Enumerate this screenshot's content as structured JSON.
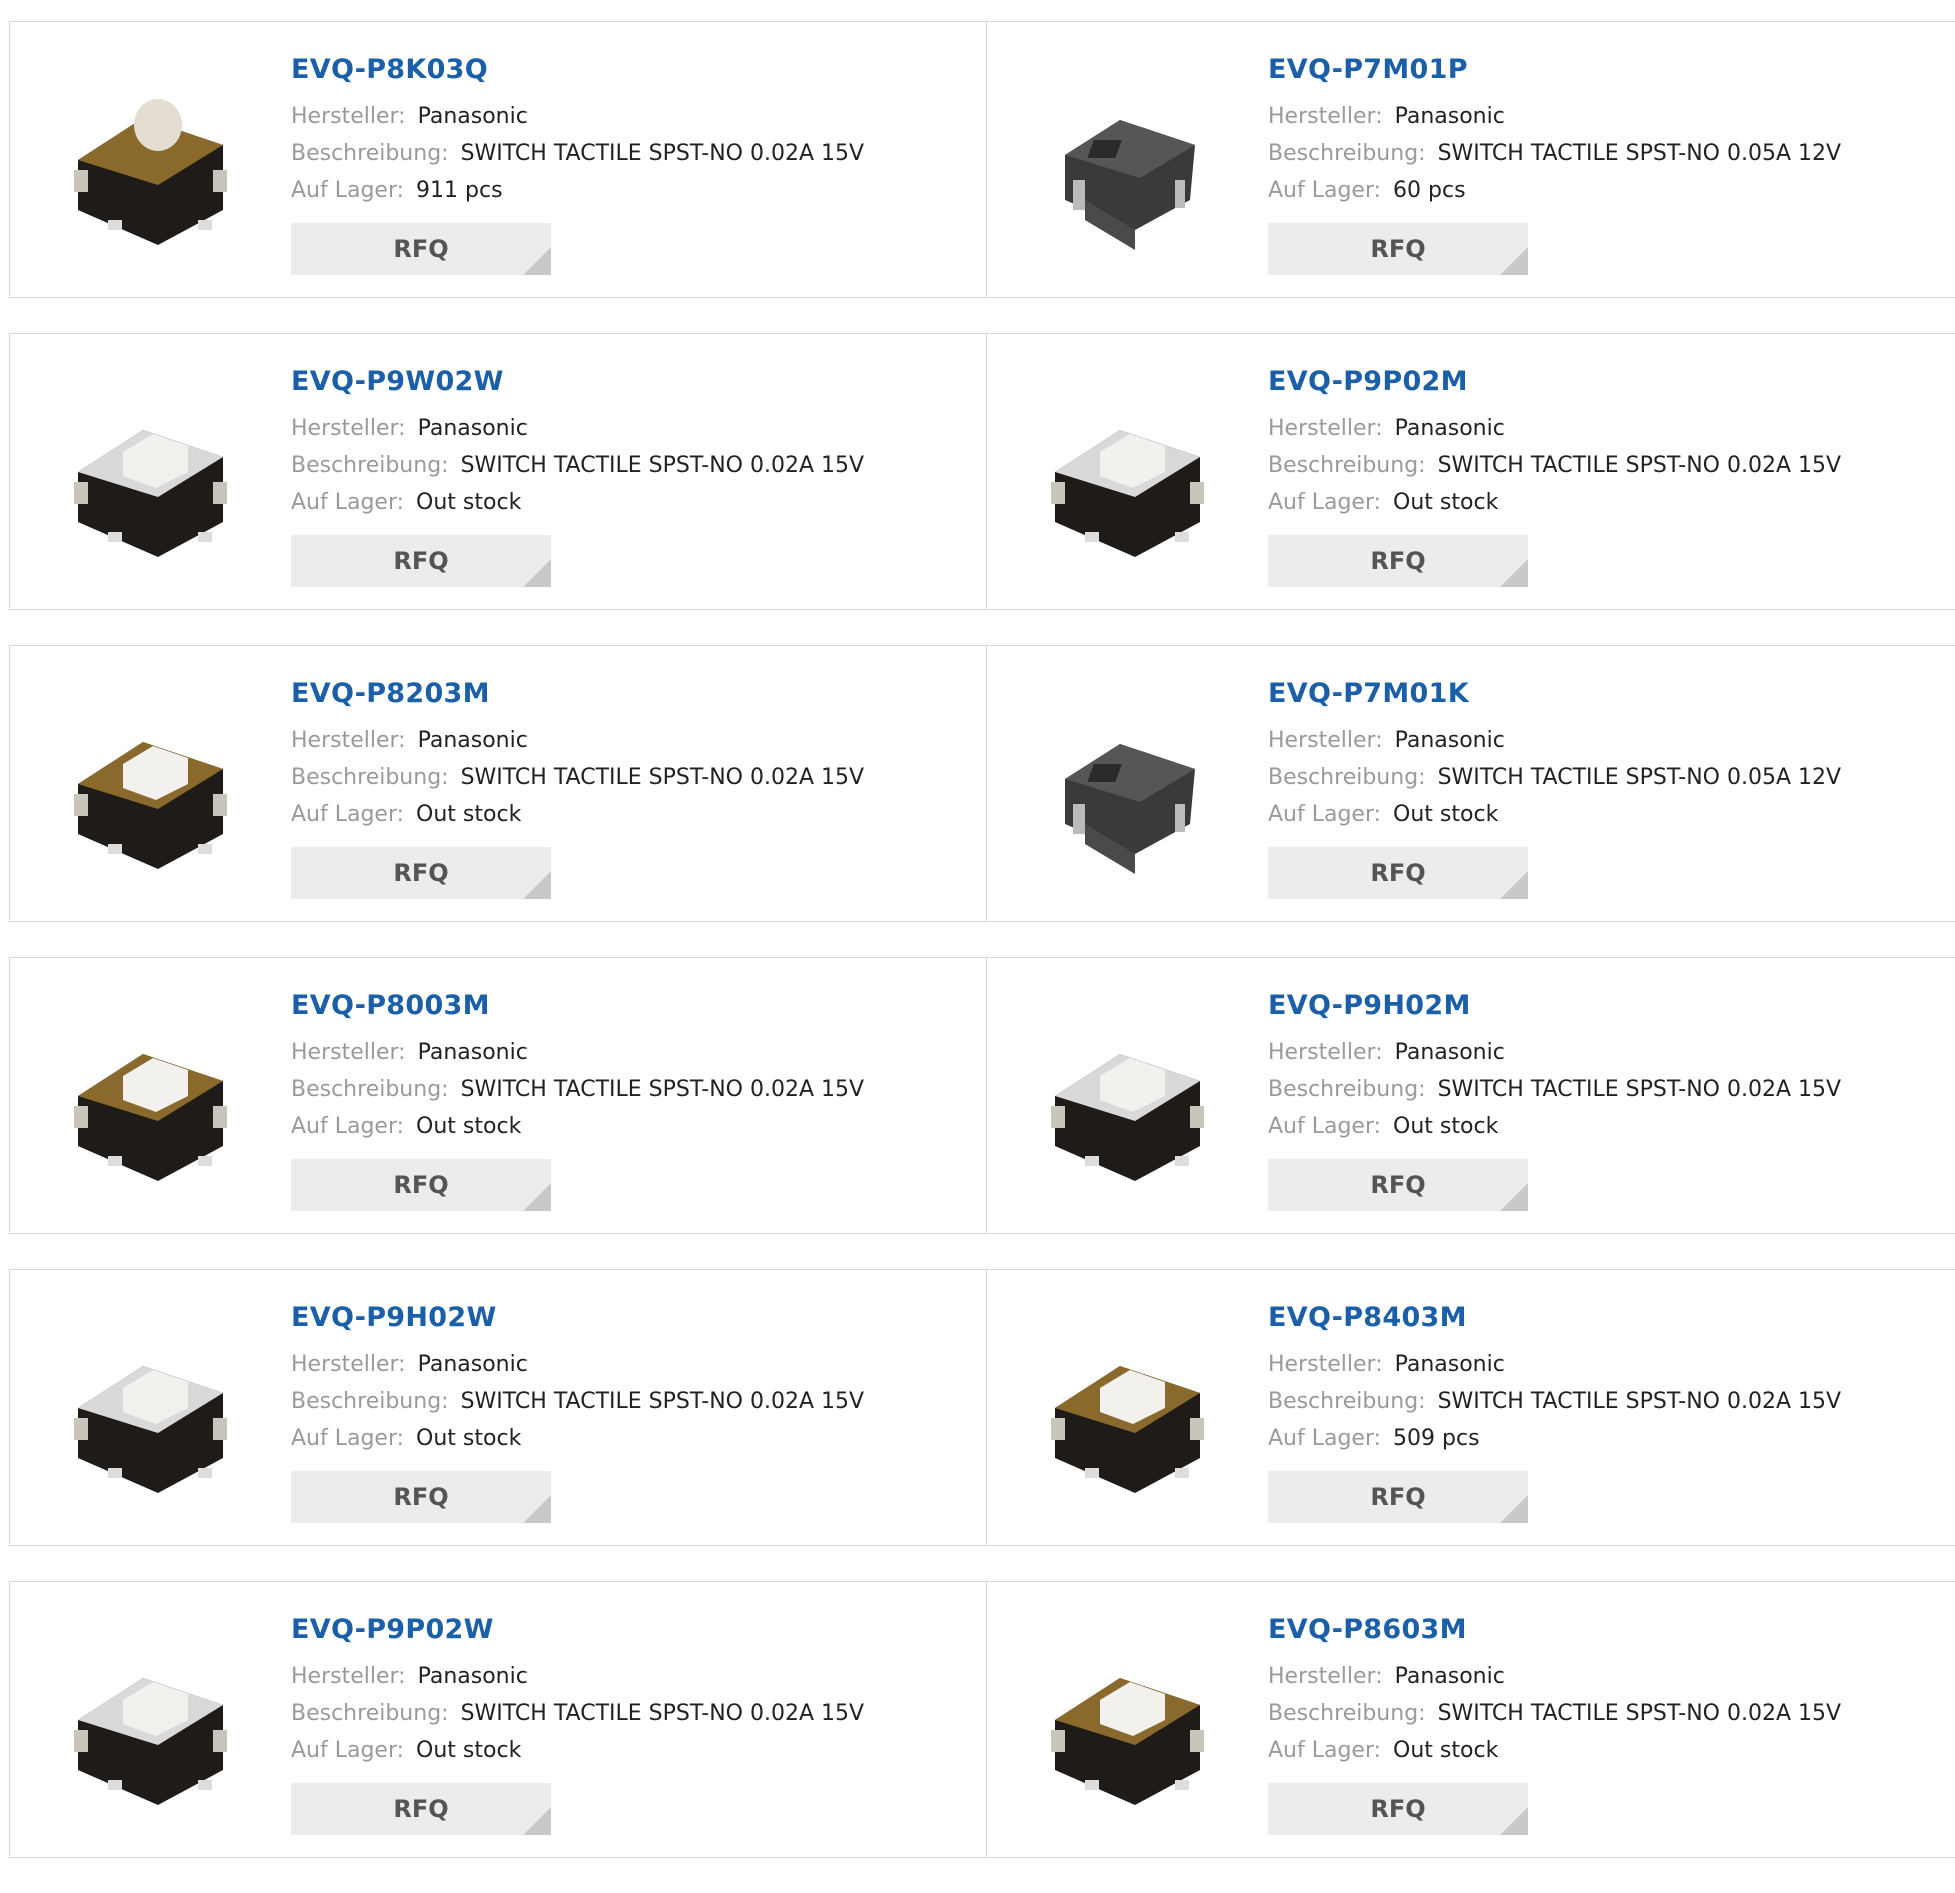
{
  "labels": {
    "manufacturer": "Hersteller:",
    "description": "Beschreibung:",
    "stock": "Auf Lager:",
    "rfq": "RFQ"
  },
  "products": [
    {
      "part": "EVQ-P8K03Q",
      "manufacturer": "Panasonic",
      "description": "SWITCH TACTILE SPST-NO 0.02A 15V",
      "stock": "911 pcs",
      "image": "switch-gold-round-icon"
    },
    {
      "part": "EVQ-P7M01P",
      "manufacturer": "Panasonic",
      "description": "SWITCH TACTILE SPST-NO 0.05A 12V",
      "stock": "60 pcs",
      "image": "switch-grey-side-icon"
    },
    {
      "part": "EVQ-P9W02W",
      "manufacturer": "Panasonic",
      "description": "SWITCH TACTILE SPST-NO 0.02A 15V",
      "stock": "Out stock",
      "image": "switch-silver-icon"
    },
    {
      "part": "EVQ-P9P02M",
      "manufacturer": "Panasonic",
      "description": "SWITCH TACTILE SPST-NO 0.02A 15V",
      "stock": "Out stock",
      "image": "switch-silver-icon"
    },
    {
      "part": "EVQ-P8203M",
      "manufacturer": "Panasonic",
      "description": "SWITCH TACTILE SPST-NO 0.02A 15V",
      "stock": "Out stock",
      "image": "switch-gold-icon"
    },
    {
      "part": "EVQ-P7M01K",
      "manufacturer": "Panasonic",
      "description": "SWITCH TACTILE SPST-NO 0.05A 12V",
      "stock": "Out stock",
      "image": "switch-grey-side-icon"
    },
    {
      "part": "EVQ-P8003M",
      "manufacturer": "Panasonic",
      "description": "SWITCH TACTILE SPST-NO 0.02A 15V",
      "stock": "Out stock",
      "image": "switch-gold-icon"
    },
    {
      "part": "EVQ-P9H02M",
      "manufacturer": "Panasonic",
      "description": "SWITCH TACTILE SPST-NO 0.02A 15V",
      "stock": "Out stock",
      "image": "switch-silver-icon"
    },
    {
      "part": "EVQ-P9H02W",
      "manufacturer": "Panasonic",
      "description": "SWITCH TACTILE SPST-NO 0.02A 15V",
      "stock": "Out stock",
      "image": "switch-silver-icon"
    },
    {
      "part": "EVQ-P8403M",
      "manufacturer": "Panasonic",
      "description": "SWITCH TACTILE SPST-NO 0.02A 15V",
      "stock": "509 pcs",
      "image": "switch-gold-icon"
    },
    {
      "part": "EVQ-P9P02W",
      "manufacturer": "Panasonic",
      "description": "SWITCH TACTILE SPST-NO 0.02A 15V",
      "stock": "Out stock",
      "image": "switch-silver-icon"
    },
    {
      "part": "EVQ-P8603M",
      "manufacturer": "Panasonic",
      "description": "SWITCH TACTILE SPST-NO 0.02A 15V",
      "stock": "Out stock",
      "image": "switch-gold-icon"
    }
  ],
  "colors": {
    "link": "#1a5fa8",
    "label": "#9a9a9a",
    "value": "#222222",
    "border": "#d6d6d6",
    "button_bg": "#ececec",
    "button_text": "#555555"
  }
}
